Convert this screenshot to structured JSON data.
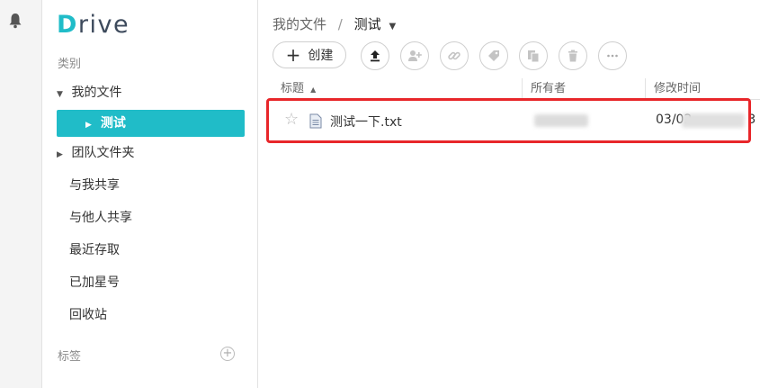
{
  "app": {
    "logo_first": "D",
    "logo_rest": "rive"
  },
  "sidebar": {
    "category_label": "类别",
    "my_files": "我的文件",
    "active_folder": "测试",
    "team_folders": "团队文件夹",
    "shared_with_me": "与我共享",
    "shared_with_others": "与他人共享",
    "recent": "最近存取",
    "starred": "已加星号",
    "recycle_bin": "回收站",
    "tags_label": "标签"
  },
  "breadcrumb": {
    "root": "我的文件",
    "separator": "/",
    "current": "测试"
  },
  "toolbar": {
    "create_label": "创建",
    "icons": [
      "upload-icon",
      "add-user-icon",
      "link-icon",
      "tag-icon",
      "copy-icon",
      "delete-icon",
      "more-icon"
    ]
  },
  "table": {
    "headers": {
      "title": "标题",
      "sort_indicator": "▲",
      "owner": "所有者",
      "modified": "修改时间"
    },
    "rows": [
      {
        "name": "测试一下.txt",
        "owner": "",
        "modified_visible_prefix": "03/02",
        "modified_visible_suffix": "3"
      }
    ]
  },
  "colors": {
    "accent": "#20bcc8",
    "highlight": "#e8262a"
  }
}
